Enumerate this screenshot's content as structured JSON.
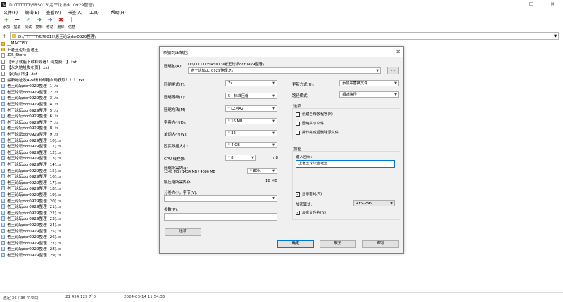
{
  "window": {
    "title": "D:\\TTTTTT\\SRS013\\老王论坛dcr0929整理\\"
  },
  "menu": [
    "文件(F)",
    "编辑(E)",
    "查看(V)",
    "书签(A)",
    "工具(T)",
    "帮助(H)"
  ],
  "toolbar": [
    {
      "label": "添加",
      "icon": "plus-icon",
      "glyph": "+",
      "color": "#2a9a2a"
    },
    {
      "label": "提取",
      "icon": "minus-icon",
      "glyph": "━",
      "color": "#2a3ab0"
    },
    {
      "label": "测试",
      "icon": "check-icon",
      "glyph": "✓",
      "color": "#1a9aa0"
    },
    {
      "label": "复制",
      "icon": "arrow-right-icon",
      "glyph": "➜",
      "color": "#2a9a2a"
    },
    {
      "label": "移动",
      "icon": "arrow-right-icon",
      "glyph": "➜",
      "color": "#2a3ab0"
    },
    {
      "label": "删除",
      "icon": "delete-x-icon",
      "glyph": "✖",
      "color": "#d02020"
    },
    {
      "label": "信息",
      "icon": "info-icon",
      "glyph": "i",
      "color": "#b09a10"
    }
  ],
  "address": {
    "path": "D:\\TTTTTT\\SRS013\\老王论坛dcr0929整理\\"
  },
  "files": [
    {
      "name": "__MACOSX",
      "type": "folder"
    },
    {
      "name": "上老王论坛当老王",
      "type": "folder"
    },
    {
      "name": ".DS_Store",
      "type": "plain"
    },
    {
      "name": "【来了就能下载和观看！纯免费！】.txt",
      "type": "txt"
    },
    {
      "name": "【永久地址发布页】.txt",
      "type": "txt"
    },
    {
      "name": "【论坛介绍】.txt",
      "type": "txt"
    },
    {
      "name": "最新地址及APP请发邮箱自动获取！！！.txt",
      "type": "txt"
    },
    {
      "name": "老王论坛dcr0929整理 (1).ts",
      "type": "ts"
    },
    {
      "name": "老王论坛dcr0929整理 (2).ts",
      "type": "ts"
    },
    {
      "name": "老王论坛dcr0929整理 (3).ts",
      "type": "ts"
    },
    {
      "name": "老王论坛dcr0929整理 (4).ts",
      "type": "ts"
    },
    {
      "name": "老王论坛dcr0929整理 (5).ts",
      "type": "ts"
    },
    {
      "name": "老王论坛dcr0929整理 (6).ts",
      "type": "ts"
    },
    {
      "name": "老王论坛dcr0929整理 (7).ts",
      "type": "ts"
    },
    {
      "name": "老王论坛dcr0929整理 (8).ts",
      "type": "ts"
    },
    {
      "name": "老王论坛dcr0929整理 (9).ts",
      "type": "ts"
    },
    {
      "name": "老王论坛dcr0929整理 (10).ts",
      "type": "ts"
    },
    {
      "name": "老王论坛dcr0929整理 (11).ts",
      "type": "ts"
    },
    {
      "name": "老王论坛dcr0929整理 (12).ts",
      "type": "ts"
    },
    {
      "name": "老王论坛dcr0929整理 (13).ts",
      "type": "ts"
    },
    {
      "name": "老王论坛dcr0929整理 (14).ts",
      "type": "ts"
    },
    {
      "name": "老王论坛dcr0929整理 (15).ts",
      "type": "ts"
    },
    {
      "name": "老王论坛dcr0929整理 (16).ts",
      "type": "ts"
    },
    {
      "name": "老王论坛dcr0929整理 (17).ts",
      "type": "ts"
    },
    {
      "name": "老王论坛dcr0929整理 (18).ts",
      "type": "ts"
    },
    {
      "name": "老王论坛dcr0929整理 (19).ts",
      "type": "ts"
    },
    {
      "name": "老王论坛dcr0929整理 (20).ts",
      "type": "ts"
    },
    {
      "name": "老王论坛dcr0929整理 (21).ts",
      "type": "ts"
    },
    {
      "name": "老王论坛dcr0929整理 (22).ts",
      "type": "ts"
    },
    {
      "name": "老王论坛dcr0929整理 (23).ts",
      "type": "ts"
    },
    {
      "name": "老王论坛dcr0929整理 (24).ts",
      "type": "ts"
    },
    {
      "name": "老王论坛dcr0929整理 (25).ts",
      "type": "ts"
    },
    {
      "name": "老王论坛dcr0929整理 (26).ts",
      "type": "ts"
    },
    {
      "name": "老王论坛dcr0929整理 (27).ts",
      "type": "ts"
    },
    {
      "name": "老王论坛dcr0929整理 (28).ts",
      "type": "ts"
    },
    {
      "name": "老王论坛dcr0929整理 (29).ts",
      "type": "ts"
    }
  ],
  "status": {
    "selected": "选定 36 / 36 个项目",
    "size": "21 454 129 7`0",
    "modified": "2024-03-14 11:54:36"
  },
  "dialog": {
    "title": "添加到压缩包",
    "archive_label": "压缩包(A):",
    "archive_dir": "D:\\TTTTTT\\SRS013\\老王论坛dcr0929整理\\",
    "archive_name": "老王论坛dcr0929整理.7z",
    "browse_label": "...",
    "format_label": "压缩格式(F):",
    "format_value": "7z",
    "level_label": "压缩等级(L):",
    "level_value": "5 - 标准压缩",
    "method_label": "压缩方法(M):",
    "method_value": "* LZMA2",
    "dict_label": "字典大小(D):",
    "dict_value": "* 16 MB",
    "word_label": "单词大小(W):",
    "word_value": "* 32",
    "solid_label": "固实数据大小:",
    "solid_value": "* 4 GB",
    "threads_label": "CPU 线程数:",
    "threads_value": "* 8",
    "threads_total": "/ 8",
    "mem_label": "压缩所需内存:",
    "mem_detail": "1248 MB / 1434 MB / 4096 MB",
    "mem_value": "* 80%",
    "decomp_label": "解压缩所需内存:",
    "decomp_value": "18 MB",
    "split_label": "分卷大小，字节(V):",
    "params_label": "参数(P):",
    "options_btn": "选项",
    "update_label": "更新方式(U):",
    "update_value": "添加并替换文件",
    "path_label": "路径模式:",
    "path_value": "相对路径",
    "options_group": "选项",
    "opt_sfx": "创建自释放程序(X)",
    "opt_shared": "压缩共享文件",
    "opt_delete": "操作完成后删除源文件",
    "enc_group": "加密",
    "pwd_label": "输入密码:",
    "pwd_value": "上老王论坛当老王",
    "show_pwd": "显示密码(S)",
    "enc_method_label": "加密算法:",
    "enc_method_value": "AES-256",
    "enc_names": "加密文件名(N)",
    "ok": "确定",
    "cancel": "取消",
    "help": "帮助"
  }
}
